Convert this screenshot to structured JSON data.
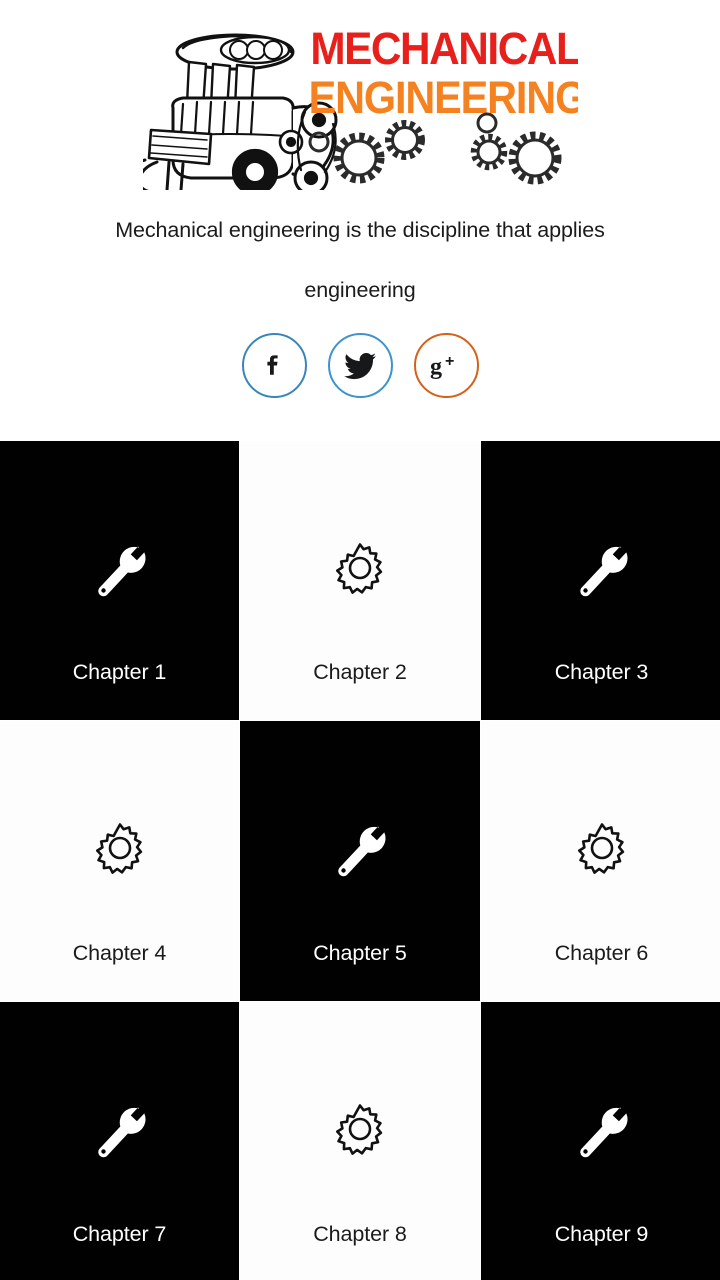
{
  "header": {
    "logo": {
      "name": "mechanical-engineering-logo",
      "line1": "MECHANICAL",
      "line2": "ENGINEERING",
      "line1_color": "#e8201c",
      "line2_color": "#f58220",
      "illustration": "engine-illustration",
      "decoration": "gears-decoration"
    },
    "tagline": {
      "line1": "Mechanical engineering is the discipline that applies",
      "line2": "engineering"
    },
    "social": [
      {
        "name": "facebook",
        "icon": "facebook-icon",
        "glyph": "f",
        "border_color": "#3a85b8"
      },
      {
        "name": "twitter",
        "icon": "twitter-icon",
        "glyph": "bird",
        "border_color": "#3f93cc"
      },
      {
        "name": "googleplus",
        "icon": "google-plus-icon",
        "glyph": "g+",
        "border_color": "#d4601a"
      }
    ]
  },
  "grid": {
    "tiles": [
      {
        "label": "Chapter 1",
        "theme": "dark",
        "icon": "wrench-icon"
      },
      {
        "label": "Chapter 2",
        "theme": "light",
        "icon": "gear-icon"
      },
      {
        "label": "Chapter 3",
        "theme": "dark",
        "icon": "wrench-icon"
      },
      {
        "label": "Chapter 4",
        "theme": "light",
        "icon": "gear-icon"
      },
      {
        "label": "Chapter 5",
        "theme": "dark",
        "icon": "wrench-icon"
      },
      {
        "label": "Chapter 6",
        "theme": "light",
        "icon": "gear-icon"
      },
      {
        "label": "Chapter 7",
        "theme": "dark",
        "icon": "wrench-icon"
      },
      {
        "label": "Chapter 8",
        "theme": "light",
        "icon": "gear-icon"
      },
      {
        "label": "Chapter 9",
        "theme": "dark",
        "icon": "wrench-icon"
      }
    ]
  },
  "colors": {
    "tile_dark": "#010101",
    "tile_light": "#fdfdfd",
    "text_dark": "#1b1b1b",
    "text_light": "#ffffff"
  }
}
